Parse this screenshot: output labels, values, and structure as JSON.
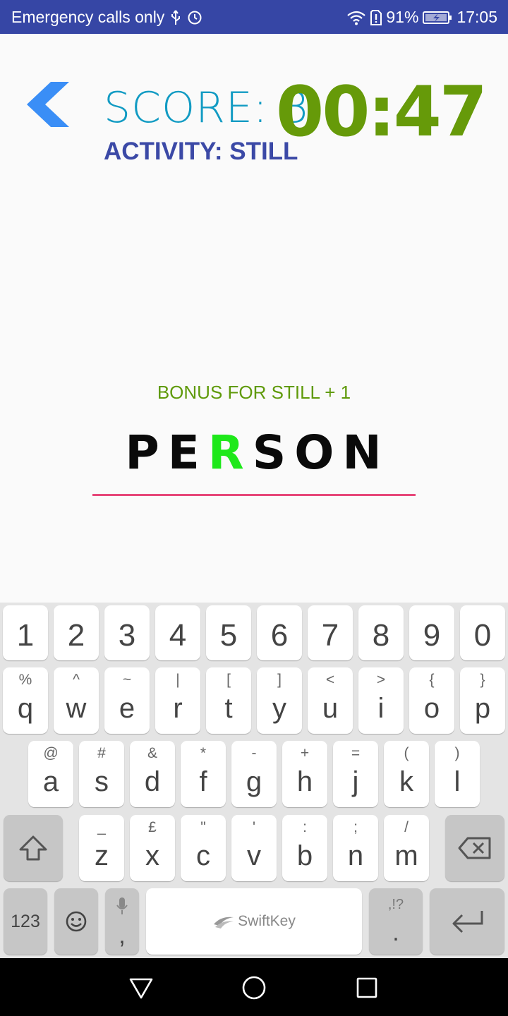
{
  "statusbar": {
    "carrier": "Emergency calls only",
    "battery": "91%",
    "time": "17:05",
    "icons": [
      "usb-icon",
      "alarm-icon",
      "wifi-icon",
      "sim-alert-icon",
      "battery-charging-icon"
    ]
  },
  "game": {
    "back_icon": "chevron-left-icon",
    "score": "SCORE: 3",
    "activity": "ACTIVITY: STILL",
    "timer": "00:47",
    "bonus": "BONUS FOR STILL + 1",
    "word_letters": [
      "P",
      "E",
      "R",
      "S",
      "O",
      "N"
    ],
    "highlight_index": 2,
    "colors": {
      "score": "#129bc3",
      "activity": "#3b49a6",
      "timer": "#669a09",
      "bonus": "#5f9a0a",
      "highlight": "#1ee81a",
      "underline": "#e64779"
    }
  },
  "keyboard": {
    "number_row": [
      "1",
      "2",
      "3",
      "4",
      "5",
      "6",
      "7",
      "8",
      "9",
      "0"
    ],
    "row1": [
      {
        "main": "q",
        "sub": "%"
      },
      {
        "main": "w",
        "sub": "^"
      },
      {
        "main": "e",
        "sub": "~"
      },
      {
        "main": "r",
        "sub": "|"
      },
      {
        "main": "t",
        "sub": "["
      },
      {
        "main": "y",
        "sub": "]"
      },
      {
        "main": "u",
        "sub": "<"
      },
      {
        "main": "i",
        "sub": ">"
      },
      {
        "main": "o",
        "sub": "{"
      },
      {
        "main": "p",
        "sub": "}"
      }
    ],
    "row2": [
      {
        "main": "a",
        "sub": "@"
      },
      {
        "main": "s",
        "sub": "#"
      },
      {
        "main": "d",
        "sub": "&"
      },
      {
        "main": "f",
        "sub": "*"
      },
      {
        "main": "g",
        "sub": "-"
      },
      {
        "main": "h",
        "sub": "+"
      },
      {
        "main": "j",
        "sub": "="
      },
      {
        "main": "k",
        "sub": "("
      },
      {
        "main": "l",
        "sub": ")"
      }
    ],
    "row3": [
      {
        "main": "z",
        "sub": "_"
      },
      {
        "main": "x",
        "sub": "£"
      },
      {
        "main": "c",
        "sub": "\""
      },
      {
        "main": "v",
        "sub": "'"
      },
      {
        "main": "b",
        "sub": ":"
      },
      {
        "main": "n",
        "sub": ";"
      },
      {
        "main": "m",
        "sub": "/"
      }
    ],
    "symbols_label": "123",
    "comma_label": ",",
    "space_label": "SwiftKey",
    "period_label": ".",
    "period_sub": ",!?",
    "icons": [
      "shift-icon",
      "backspace-icon",
      "emoji-icon",
      "microphone-icon",
      "enter-icon",
      "swiftkey-logo-icon"
    ]
  },
  "navbar": {
    "icons": [
      "back-triangle-icon",
      "home-circle-icon",
      "recents-square-icon"
    ]
  }
}
